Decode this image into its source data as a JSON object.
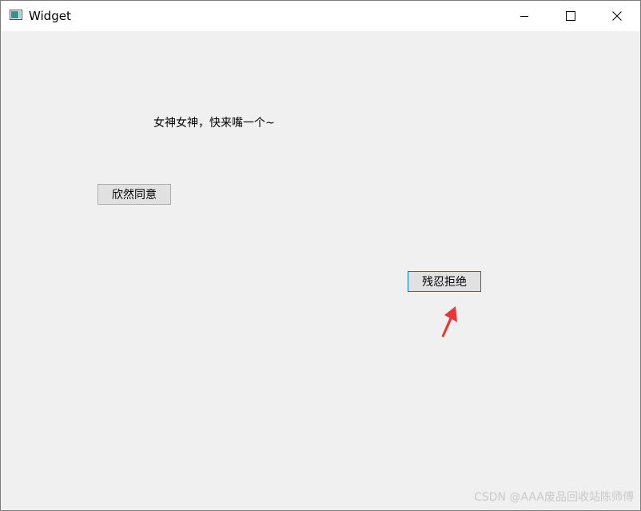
{
  "window": {
    "title": "Widget"
  },
  "content": {
    "message": "女神女神，快来嘴一个~",
    "agree_label": "欣然同意",
    "refuse_label": "残忍拒绝"
  },
  "watermark": "CSDN @AAA废品回收站陈师傅",
  "icons": {
    "app": "app-window-icon",
    "minimize": "minimize-icon",
    "maximize": "maximize-icon",
    "close": "close-icon",
    "annotation": "red-arrow-icon"
  },
  "colors": {
    "focus_border": "#0078d7",
    "annotation_arrow": "#ee3434"
  }
}
